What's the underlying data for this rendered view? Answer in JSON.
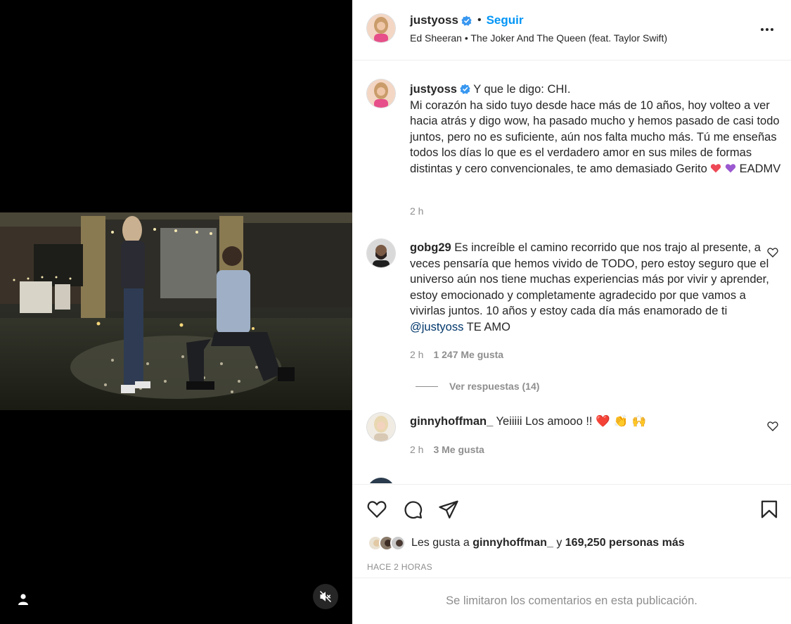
{
  "post": {
    "author": "justyoss",
    "follow_label": "Seguir",
    "separator": "•",
    "music": "Ed Sheeran • The Joker And The Queen (feat. Taylor Swift)"
  },
  "caption": {
    "author": "justyoss",
    "text_line_1": "Y que le digo: CHI.",
    "text_body": "Mi corazón ha sido tuyo desde hace más de 10 años, hoy volteo a ver hacia atrás y digo wow, ha pasado mucho y hemos pasado de casi todo juntos, pero no es suficiente, aún nos falta mucho más. Tú me enseñas todos los días lo que es el verdadero amor en sus miles de formas distintas y cero convencionales, te amo demasiado Gerito",
    "text_tail": "EADMV",
    "time": "2 h"
  },
  "comments": [
    {
      "author": "gobg29",
      "text": "Es increíble el camino recorrido que nos trajo al presente, a veces pensaría que hemos vivido de TODO, pero estoy seguro que el universo aún nos tiene muchas experiencias más por vivir y aprender, estoy emocionado y completamente agradecido por que vamos a vivirlas juntos. 10 años y estoy cada día más enamorado de ti",
      "mention": "@justyoss",
      "text_end": "TE AMO",
      "time": "2 h",
      "likes": "1 247 Me gusta",
      "replies": "Ver respuestas (14)"
    },
    {
      "author": "ginnyhoffman_",
      "text": "Yeiiiii Los amooo !!",
      "emojis": "❤️ 👏 🙌",
      "time": "2 h",
      "likes": "3 Me gusta"
    }
  ],
  "likes": {
    "prefix": "Les gusta a",
    "user": "ginnyhoffman_",
    "joiner": "y",
    "others": "169,250 personas más"
  },
  "timestamp": "HACE 2 HORAS",
  "footer_notice": "Se limitaron los comentarios en esta publicación.",
  "colors": {
    "accent": "#0095f6",
    "verified": "#3897f0",
    "heart_red": "#ed4956",
    "heart_purple": "#9b59d0",
    "mention": "#00376b"
  },
  "icons": [
    "user-tag-icon",
    "mute-icon",
    "verified-icon",
    "more-icon",
    "heart-icon",
    "comment-icon",
    "share-icon",
    "save-icon"
  ]
}
